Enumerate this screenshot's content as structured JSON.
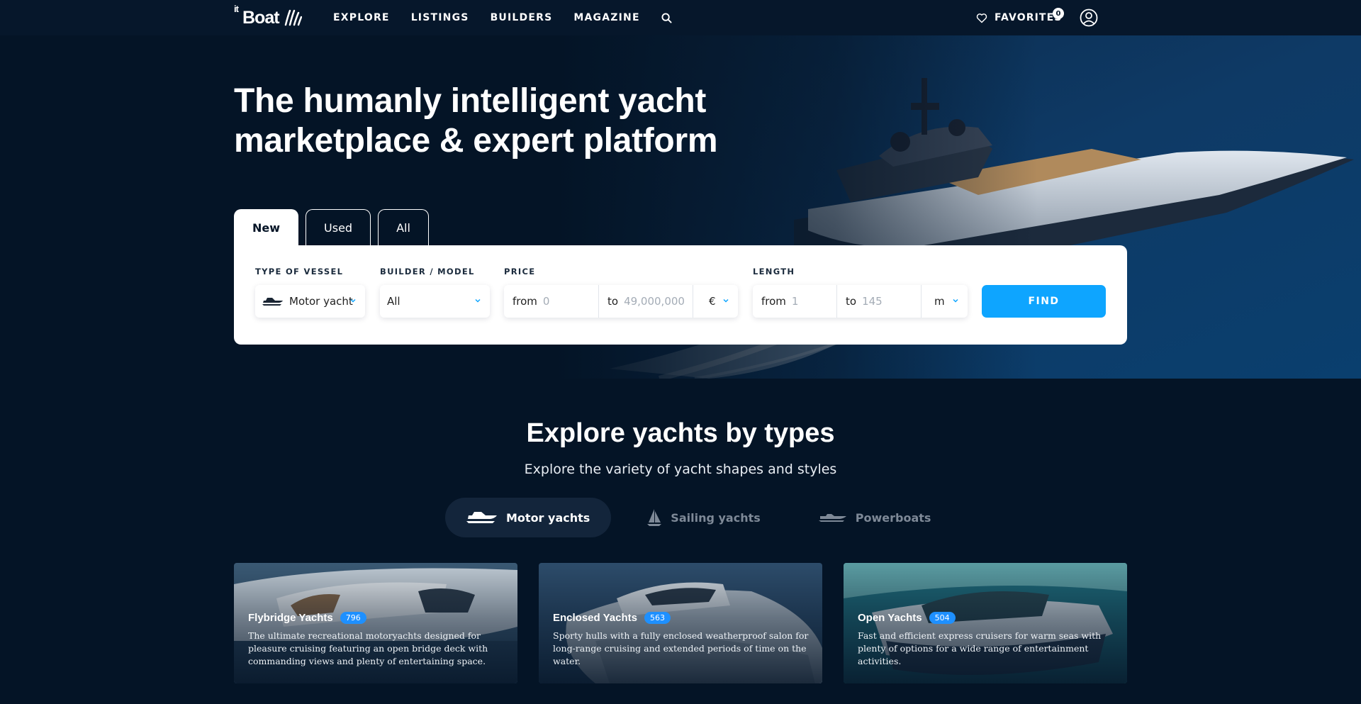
{
  "header": {
    "logo": {
      "sup": "it",
      "text": "Boat"
    },
    "nav": [
      "EXPLORE",
      "LISTINGS",
      "BUILDERS",
      "MAGAZINE"
    ],
    "favorites_label": "FAVORITES",
    "favorites_count": "0"
  },
  "hero": {
    "title_line1": "The humanly intelligent yacht",
    "title_line2": "marketplace & expert platform",
    "tabs": [
      "New",
      "Used",
      "All"
    ],
    "active_tab": "New"
  },
  "search": {
    "vessel_label": "TYPE OF VESSEL",
    "vessel_value": "Motor yacht",
    "builder_label": "BUILDER / MODEL",
    "builder_value": "All",
    "price_label": "PRICE",
    "price_from_prefix": "from",
    "price_from_placeholder": "0",
    "price_to_prefix": "to",
    "price_to_placeholder": "49,000,000",
    "currency": "€",
    "length_label": "LENGTH",
    "length_from_prefix": "from",
    "length_from_placeholder": "1",
    "length_to_prefix": "to",
    "length_to_placeholder": "145",
    "length_unit": "m",
    "find_label": "FIND"
  },
  "explore": {
    "title": "Explore yachts by types",
    "subtitle": "Explore the variety of yacht shapes and styles",
    "type_tabs": [
      "Motor yachts",
      "Sailing yachts",
      "Powerboats"
    ],
    "active_type": "Motor yachts",
    "cards": [
      {
        "title": "Flybridge Yachts",
        "count": "796",
        "desc": "The ultimate recreational motoryachts designed for pleasure cruising featuring an open bridge deck with commanding views and plenty of entertaining space."
      },
      {
        "title": "Enclosed Yachts",
        "count": "563",
        "desc": "Sporty hulls with a fully enclosed weatherproof salon for long-range cruising and extended periods of time on the water."
      },
      {
        "title": "Open Yachts",
        "count": "504",
        "desc": "Fast and efficient express cruisers for warm seas with plenty of options for a wide range of entertainment activities."
      }
    ]
  },
  "colors": {
    "background": "#041426",
    "accent": "#0ea5ff",
    "badge": "#1e90ff",
    "panel": "#ffffff"
  }
}
